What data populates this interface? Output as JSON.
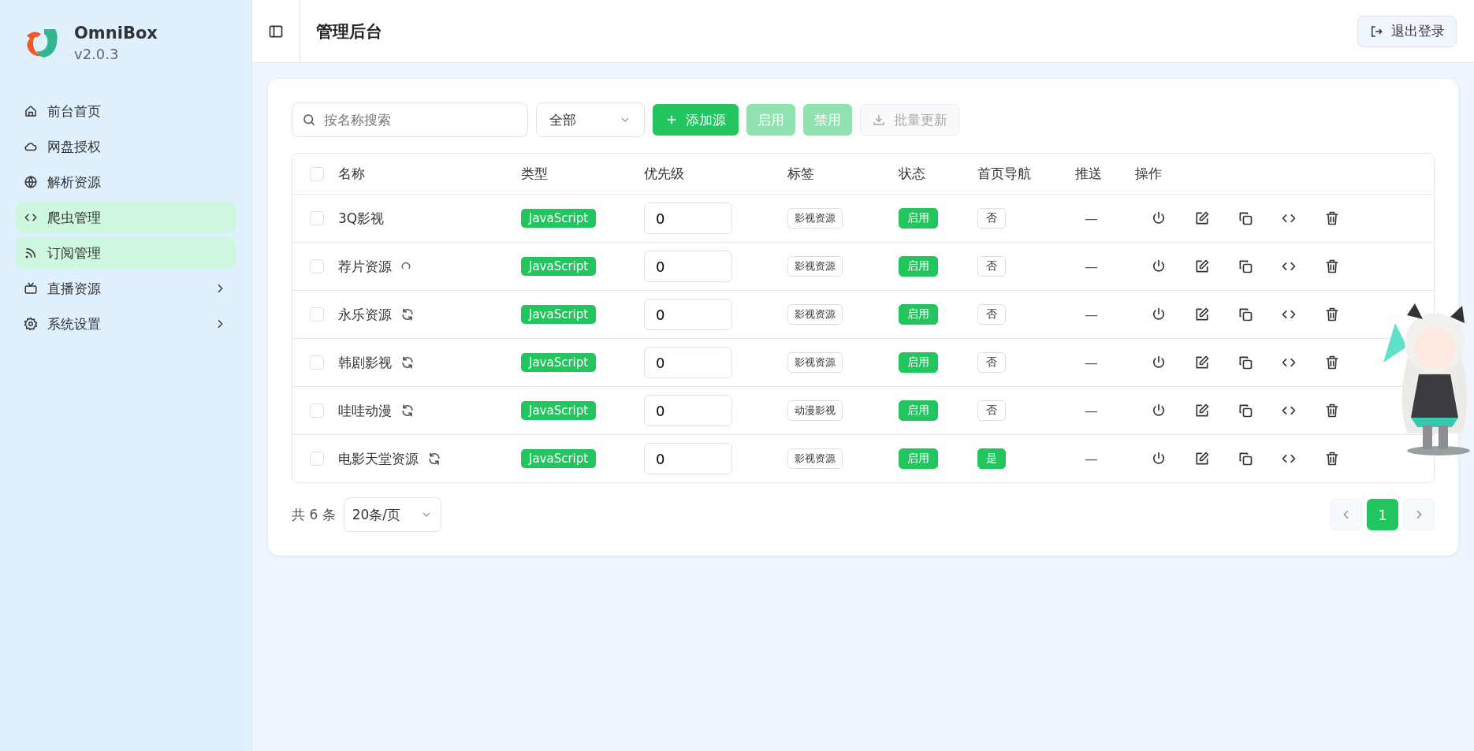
{
  "app": {
    "name": "OmniBox",
    "version": "v2.0.3"
  },
  "sidebar": {
    "items": [
      {
        "label": "前台首页",
        "kind": "link",
        "selected": false
      },
      {
        "label": "网盘授权",
        "kind": "link",
        "selected": false
      },
      {
        "label": "解析资源",
        "kind": "link",
        "selected": false
      },
      {
        "label": "爬虫管理",
        "kind": "link",
        "selected": true
      },
      {
        "label": "订阅管理",
        "kind": "link",
        "selected": true
      },
      {
        "label": "直播资源",
        "kind": "group",
        "selected": false
      },
      {
        "label": "系统设置",
        "kind": "group",
        "selected": false
      }
    ]
  },
  "header": {
    "title": "管理后台",
    "logout": "退出登录"
  },
  "toolbar": {
    "search": {
      "placeholder": "按名称搜索"
    },
    "filter": "全部",
    "buttons": [
      {
        "label": "添加源",
        "kind": "add",
        "disabled": false
      },
      {
        "label": "启用",
        "kind": "plain",
        "disabled": true
      },
      {
        "label": "禁用",
        "kind": "plain",
        "disabled": true
      },
      {
        "label": "批量更新",
        "kind": "download",
        "disabled": true
      }
    ]
  },
  "table": {
    "all_checked": false,
    "columns": [
      "名称",
      "类型",
      "优先级",
      "标签",
      "状态",
      "首页导航",
      "推送",
      "操作"
    ],
    "rows": [
      {
        "checked": false,
        "name": "3Q影视",
        "kind": "plain",
        "type": "JavaScript",
        "priority": "0",
        "tag": "影视资源",
        "status": {
          "label": "启用",
          "on": true
        },
        "home_nav": {
          "label": "否",
          "on": false
        },
        "push": "—"
      },
      {
        "checked": false,
        "name": "荐片资源",
        "kind": "loading",
        "type": "JavaScript",
        "priority": "0",
        "tag": "影视资源",
        "status": {
          "label": "启用",
          "on": true
        },
        "home_nav": {
          "label": "否",
          "on": false
        },
        "push": "—"
      },
      {
        "checked": false,
        "name": "永乐资源",
        "kind": "refreshable",
        "type": "JavaScript",
        "priority": "0",
        "tag": "影视资源",
        "status": {
          "label": "启用",
          "on": true
        },
        "home_nav": {
          "label": "否",
          "on": false
        },
        "push": "—"
      },
      {
        "checked": false,
        "name": "韩剧影视",
        "kind": "refreshable",
        "type": "JavaScript",
        "priority": "0",
        "tag": "影视资源",
        "status": {
          "label": "启用",
          "on": true
        },
        "home_nav": {
          "label": "否",
          "on": false
        },
        "push": "—"
      },
      {
        "checked": false,
        "name": "哇哇动漫",
        "kind": "refreshable",
        "type": "JavaScript",
        "priority": "0",
        "tag": "动漫影视",
        "status": {
          "label": "启用",
          "on": true
        },
        "home_nav": {
          "label": "否",
          "on": false
        },
        "push": "—"
      },
      {
        "checked": false,
        "name": "电影天堂资源",
        "kind": "refreshable",
        "type": "JavaScript",
        "priority": "0",
        "tag": "影视资源",
        "status": {
          "label": "启用",
          "on": true
        },
        "home_nav": {
          "label": "是",
          "on": true
        },
        "push": "—"
      }
    ]
  },
  "pagination": {
    "total": "共 6 条",
    "page_size": "20条/页",
    "pages": [
      {
        "label": "1",
        "selected": true
      }
    ]
  }
}
